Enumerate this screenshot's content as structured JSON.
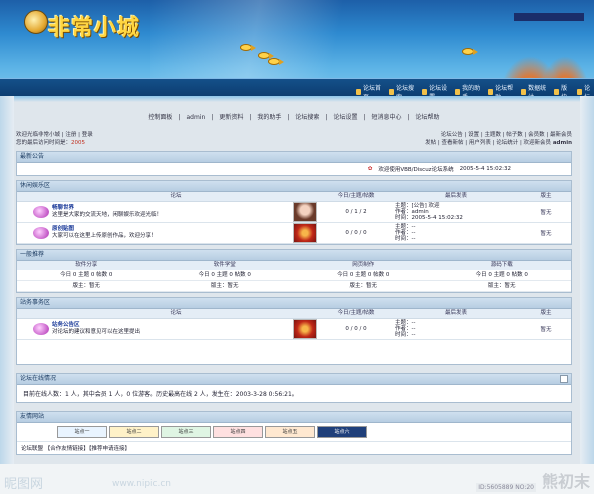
{
  "banner": {
    "logo_text": "非常小城",
    "navbar": [
      "论坛首页",
      "论坛搜索",
      "论坛设置",
      "我的助手",
      "论坛帮助",
      "数据统计",
      "版块",
      "论坛"
    ]
  },
  "subnav": [
    "控制面板",
    "admin",
    "更新资料",
    "我的助手",
    "论坛搜索",
    "论坛设置",
    "短消息中心",
    "论坛帮助"
  ],
  "info": {
    "left1": "欢迎光临非常小城 | 注册 | 登录",
    "left2": "您的最后访问时间是：",
    "left2_hl": "2005",
    "right1": "论坛公告 | 设置 | 主题数 | 帖子数 | 会员数 | 最新会员",
    "right2": "发帖 | 查看新帖 | 用户列表 | 论坛统计 | 欢迎新会员",
    "right2_user": "admin"
  },
  "notice": {
    "title": "最新公告",
    "text": "欢迎使用VBB/Discuz论坛系统",
    "meta": "2005-5-4 15:02:32"
  },
  "forum_group1": {
    "title": "休闲娱乐区",
    "headers": [
      "论坛",
      "今日/主题/帖数",
      "最后发表",
      "版主"
    ],
    "rows": [
      {
        "name": "畅聊世界",
        "desc": "这里是大家的交流天地，闲聊娱乐欢迎光临！",
        "stats": "0 / 1 / 2",
        "last1": "主题：[公告] 欢迎",
        "last2": "作者：admin",
        "last3": "时间：2005-5-4 15:02:32",
        "mod": "暂无"
      },
      {
        "name": "原创贴图",
        "desc": "大家可以在这里上传原创作品，欢迎分享！",
        "stats": "0 / 0 / 0",
        "last1": "主题：--",
        "last2": "作者：--",
        "last3": "时间：--",
        "mod": "暂无"
      }
    ]
  },
  "links": {
    "title": "一般推荐",
    "headers": [
      "软件分享",
      "软件学堂",
      "网页制作",
      "源码下载"
    ],
    "r1": [
      "今日 0 主题 0 帖数 0",
      "今日 0 主题 0 帖数 0",
      "今日 0 主题 0 帖数 0",
      "今日 0 主题 0 帖数 0"
    ],
    "r2": [
      "版主：暂无",
      "版主：暂无",
      "版主：暂无",
      "版主：暂无"
    ]
  },
  "forum_group2": {
    "title": "站务事务区",
    "headers": [
      "论坛",
      "今日/主题/帖数",
      "最后发表",
      "版主"
    ],
    "rows": [
      {
        "name": "站务公告区",
        "desc": "对论坛的建议和意见可以在这里提出",
        "stats": "0 / 0 / 0",
        "last1": "主题：--",
        "last2": "作者：--",
        "last3": "时间：--",
        "mod": "暂无"
      }
    ]
  },
  "stats": {
    "title": "论坛在线情况",
    "text": "目前在线人数：1 人，其中会员 1 人，0 位游客。历史最高在线 2 人，发生在：2003-3-28 0:56:21。"
  },
  "friends": {
    "title": "友情网站",
    "logos": [
      "站点一",
      "站点二",
      "站点三",
      "站点四",
      "站点五",
      "站点六"
    ],
    "footer": "论坛联盟 【合作友情链接】【推荐申请连接】"
  },
  "watermark": {
    "brand": "昵图网",
    "url": "www.nipic.cn",
    "id": "ID:5605889 NO:20",
    "corner": "熊初末"
  }
}
